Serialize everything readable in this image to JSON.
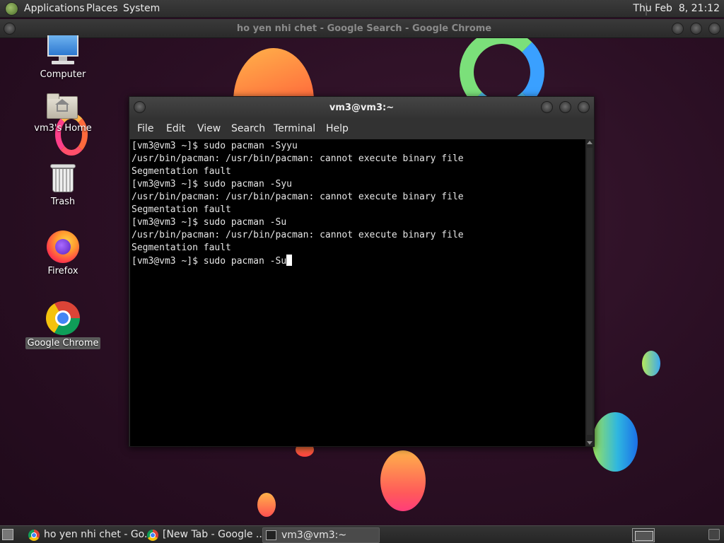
{
  "top_panel": {
    "menus": [
      "Applications",
      "Places",
      "System"
    ],
    "clock": "Thu Feb  8, 21:12"
  },
  "chrome_window": {
    "title": "ho yen nhi chet - Google Search - Google Chrome"
  },
  "desktop_icons": [
    {
      "label": "Computer",
      "icon": "computer-icon"
    },
    {
      "label": "vm3's Home",
      "icon": "home-folder-icon"
    },
    {
      "label": "Trash",
      "icon": "trash-icon"
    },
    {
      "label": "Firefox",
      "icon": "firefox-icon"
    },
    {
      "label": "Google Chrome",
      "icon": "chrome-icon",
      "selected": true
    }
  ],
  "terminal": {
    "title": "vm3@vm3:~",
    "menu": [
      "File",
      "Edit",
      "View",
      "Search",
      "Terminal",
      "Help"
    ],
    "lines": [
      "[vm3@vm3 ~]$ sudo pacman -Syyu",
      "/usr/bin/pacman: /usr/bin/pacman: cannot execute binary file",
      "Segmentation fault",
      "[vm3@vm3 ~]$ sudo pacman -Syu",
      "/usr/bin/pacman: /usr/bin/pacman: cannot execute binary file",
      "Segmentation fault",
      "[vm3@vm3 ~]$ sudo pacman -Su",
      "/usr/bin/pacman: /usr/bin/pacman: cannot execute binary file",
      "Segmentation fault"
    ],
    "prompt": "[vm3@vm3 ~]$ sudo pacman -Su"
  },
  "taskbar": {
    "tasks": [
      {
        "label": "ho yen nhi chet - Go...",
        "icon": "chrome-icon"
      },
      {
        "label": "[New Tab - Google ...",
        "icon": "chrome-icon"
      },
      {
        "label": "vm3@vm3:~",
        "icon": "terminal-icon",
        "active": true
      }
    ]
  },
  "colors": {
    "desktop_bg": "#2b0f24",
    "panel_bg": "#2c2c2c",
    "terminal_bg": "#000000",
    "terminal_fg": "#e6e6e6"
  }
}
